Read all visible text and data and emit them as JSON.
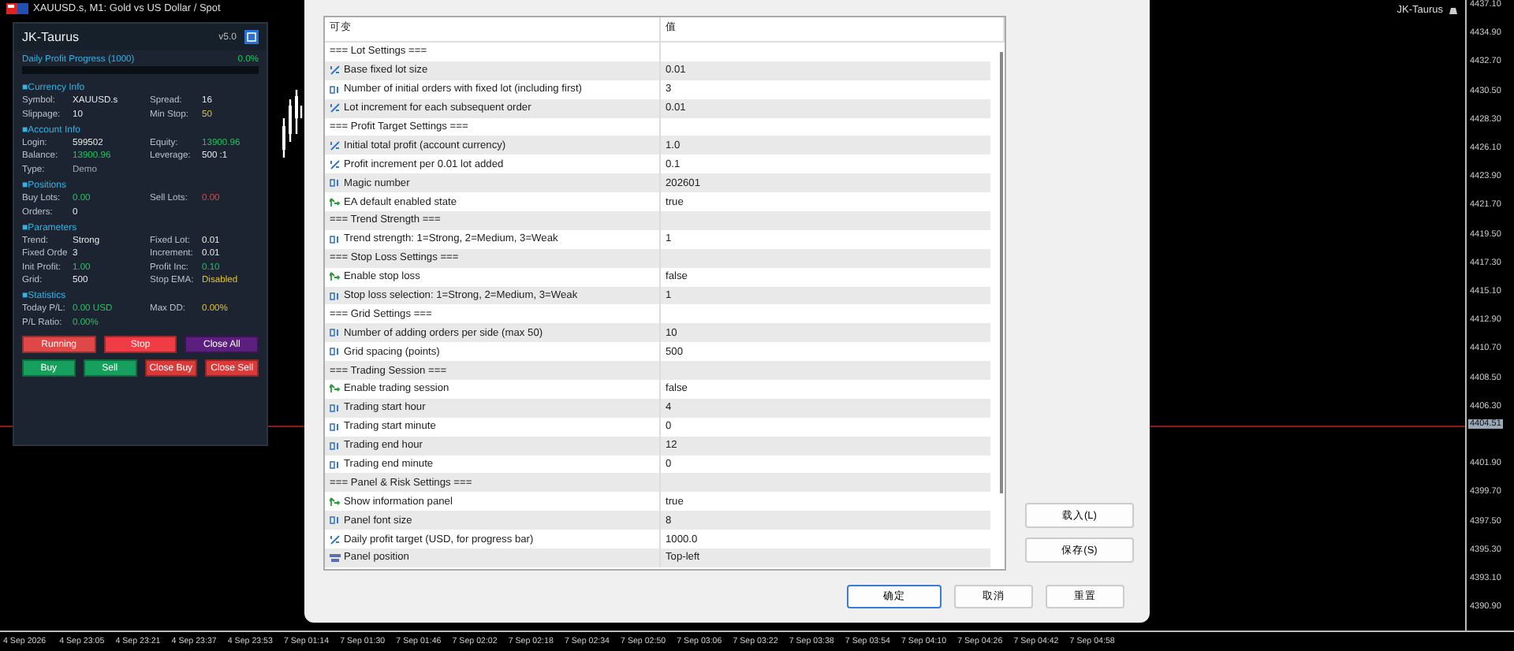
{
  "chart": {
    "symbol_title": "XAUUSD.s, M1: Gold vs US Dollar / Spot",
    "ea_label": "JK-Taurus",
    "price_labels": [
      "4437.10",
      "4434.90",
      "4432.70",
      "4430.50",
      "4428.30",
      "4426.10",
      "4423.90",
      "4421.70",
      "4419.50",
      "4417.30",
      "4415.10",
      "4412.90",
      "4410.70",
      "4408.50",
      "4406.30",
      "4401.90",
      "4399.70",
      "4397.50",
      "4395.30",
      "4393.10",
      "4390.90"
    ],
    "current_price": "4404.51",
    "time_labels": [
      "4 Sep 2026",
      "4 Sep 23:05",
      "4 Sep 23:21",
      "4 Sep 23:37",
      "4 Sep 23:53",
      "7 Sep 01:14",
      "7 Sep 01:30",
      "7 Sep 01:46",
      "7 Sep 02:02",
      "7 Sep 02:18",
      "7 Sep 02:34",
      "7 Sep 02:50",
      "7 Sep 03:06",
      "7 Sep 03:22",
      "7 Sep 03:38",
      "7 Sep 03:54",
      "7 Sep 04:10",
      "7 Sep 04:26",
      "7 Sep 04:42",
      "7 Sep 04:58"
    ]
  },
  "panel": {
    "title": "JK-Taurus",
    "version": "v5.0",
    "progress": {
      "label": "Daily Profit Progress (1000)",
      "value": "0.0%",
      "level": 0
    },
    "sections": [
      {
        "title": "■Currency Info",
        "rows": [
          [
            {
              "label": "Symbol:",
              "value": "XAUUSD.s"
            },
            {
              "label": "Spread:",
              "value": "16"
            }
          ],
          [
            {
              "label": "Slippage:",
              "value": "10"
            },
            {
              "label": "Min Stop:",
              "value": "50",
              "color": "#e6c229"
            }
          ]
        ]
      },
      {
        "title": "■Account Info",
        "rows": [
          [
            {
              "label": "Login:",
              "value": "599502"
            },
            {
              "label": "Equity:",
              "value": "13900.96",
              "color": "#22c55e"
            }
          ],
          [
            {
              "label": "Balance:",
              "value": "13900.96",
              "color": "#22c55e"
            },
            {
              "label": "Leverage:",
              "value": "500 :1"
            }
          ],
          [
            {
              "label": "Type:",
              "value": "Demo",
              "color": "#a0a8b0"
            }
          ]
        ]
      },
      {
        "title": "■Positions",
        "rows": [
          [
            {
              "label": "Buy Lots:",
              "value": "0.00",
              "color": "#22c55e"
            },
            {
              "label": "Sell Lots:",
              "value": "0.00",
              "color": "#e04545"
            }
          ],
          [
            {
              "label": "Orders:",
              "value": "0"
            }
          ]
        ]
      },
      {
        "title": "■Parameters",
        "rows": [
          [
            {
              "label": "Trend:",
              "value": "Strong"
            },
            {
              "label": "Fixed Lot:",
              "value": "0.01"
            }
          ],
          [
            {
              "label": "Fixed Orde",
              "value": "3"
            },
            {
              "label": "Increment:",
              "value": "0.01"
            }
          ],
          [
            {
              "label": "Init Profit:",
              "value": "1.00",
              "color": "#22c55e"
            },
            {
              "label": "Profit Inc:",
              "value": "0.10",
              "color": "#22c55e"
            }
          ],
          [
            {
              "label": "Grid:",
              "value": "500"
            },
            {
              "label": "Stop EMA:",
              "value": "Disabled",
              "color": "#e6c229"
            }
          ]
        ]
      },
      {
        "title": "■Statistics",
        "rows": [
          [
            {
              "label": "Today P/L:",
              "value": "0.00 USD",
              "color": "#22c55e"
            },
            {
              "label": "Max DD:",
              "value": "0.00%",
              "color": "#e6c229"
            }
          ],
          [
            {
              "label": "P/L Ratio:",
              "value": "0.00%",
              "color": "#22c55e"
            }
          ]
        ]
      }
    ],
    "buttons": [
      [
        {
          "label": "Running",
          "color": "#e04848"
        },
        {
          "label": "Stop",
          "color": "#f03c44"
        },
        {
          "label": "Close All",
          "color": "#5b1f7e"
        }
      ],
      [
        {
          "label": "Buy",
          "color": "#17a05d"
        },
        {
          "label": "Sell",
          "color": "#17a05d"
        },
        {
          "label": "Close Buy",
          "color": "#d93b3b"
        },
        {
          "label": "Close Sell",
          "color": "#d93b3b"
        }
      ]
    ]
  },
  "dialog": {
    "columns": [
      "可变",
      "值"
    ],
    "rows": [
      {
        "kind": "section",
        "name": "=== Lot Settings ==="
      },
      {
        "kind": "double",
        "name": "Base fixed lot size",
        "value": "0.01"
      },
      {
        "kind": "int",
        "name": "Number of initial orders with fixed lot (including first)",
        "value": "3"
      },
      {
        "kind": "double",
        "name": "Lot increment for each subsequent order",
        "value": "0.01"
      },
      {
        "kind": "section",
        "name": "=== Profit Target Settings ==="
      },
      {
        "kind": "double",
        "name": "Initial total profit (account currency)",
        "value": "1.0"
      },
      {
        "kind": "double",
        "name": "Profit increment per 0.01 lot added",
        "value": "0.1"
      },
      {
        "kind": "int",
        "name": "Magic number",
        "value": "202601"
      },
      {
        "kind": "bool",
        "name": "EA default enabled state",
        "value": "true"
      },
      {
        "kind": "section",
        "name": "=== Trend Strength ==="
      },
      {
        "kind": "int",
        "name": "Trend strength: 1=Strong, 2=Medium, 3=Weak",
        "value": "1"
      },
      {
        "kind": "section",
        "name": "=== Stop Loss Settings ==="
      },
      {
        "kind": "bool",
        "name": "Enable stop loss",
        "value": "false"
      },
      {
        "kind": "int",
        "name": "Stop loss selection: 1=Strong, 2=Medium, 3=Weak",
        "value": "1"
      },
      {
        "kind": "section",
        "name": "=== Grid Settings ==="
      },
      {
        "kind": "int",
        "name": "Number of adding orders per side (max 50)",
        "value": "10"
      },
      {
        "kind": "int",
        "name": "Grid spacing (points)",
        "value": "500"
      },
      {
        "kind": "section",
        "name": "=== Trading Session ==="
      },
      {
        "kind": "bool",
        "name": "Enable trading session",
        "value": "false"
      },
      {
        "kind": "int",
        "name": "Trading start hour",
        "value": "4"
      },
      {
        "kind": "int",
        "name": "Trading start minute",
        "value": "0"
      },
      {
        "kind": "int",
        "name": "Trading end hour",
        "value": "12"
      },
      {
        "kind": "int",
        "name": "Trading end minute",
        "value": "0"
      },
      {
        "kind": "section",
        "name": "=== Panel & Risk Settings ==="
      },
      {
        "kind": "bool",
        "name": "Show information panel",
        "value": "true"
      },
      {
        "kind": "int",
        "name": "Panel font size",
        "value": "8"
      },
      {
        "kind": "double",
        "name": "Daily profit target (USD, for progress bar)",
        "value": "1000.0"
      },
      {
        "kind": "enum",
        "name": "Panel position",
        "value": "Top-left"
      }
    ],
    "side_buttons": [
      "载入(L)",
      "保存(S)"
    ],
    "buttons": [
      "确定",
      "取消",
      "重置"
    ]
  }
}
